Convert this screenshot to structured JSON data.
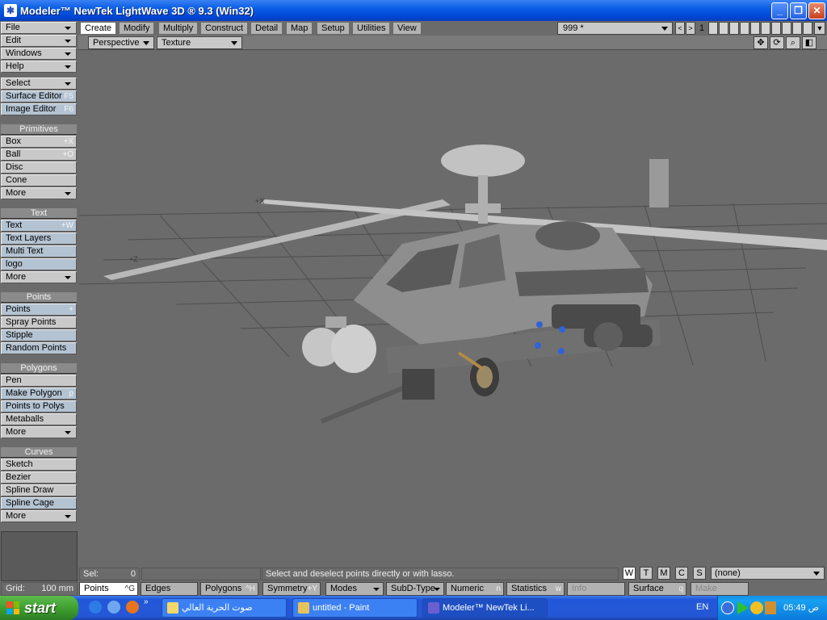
{
  "window": {
    "title": "Modeler™ NewTek LightWave 3D ® 9.3 (Win32)",
    "controls": [
      "_",
      "❐",
      "✕"
    ]
  },
  "left_menu": {
    "top": [
      {
        "label": "File"
      },
      {
        "label": "Edit"
      },
      {
        "label": "Windows"
      },
      {
        "label": "Help"
      }
    ],
    "tools": [
      {
        "label": "Select"
      },
      {
        "label": "Surface Editor",
        "shortcut": "F5"
      },
      {
        "label": "Image Editor",
        "shortcut": "F6"
      }
    ],
    "primitives": {
      "header": "Primitives",
      "items": [
        {
          "label": "Box",
          "shortcut": "+X"
        },
        {
          "label": "Ball",
          "shortcut": "+O"
        },
        {
          "label": "Disc"
        },
        {
          "label": "Cone"
        },
        {
          "label": "More"
        }
      ]
    },
    "text": {
      "header": "Text",
      "items": [
        {
          "label": "Text",
          "shortcut": "+W"
        },
        {
          "label": "Text Layers"
        },
        {
          "label": "Multi Text"
        },
        {
          "label": "logo"
        },
        {
          "label": "More"
        }
      ]
    },
    "points": {
      "header": "Points",
      "items": [
        {
          "label": "Points",
          "shortcut": "+"
        },
        {
          "label": "Spray Points"
        },
        {
          "label": "Stipple"
        },
        {
          "label": "Random Points"
        }
      ]
    },
    "polygons": {
      "header": "Polygons",
      "items": [
        {
          "label": "Pen"
        },
        {
          "label": "Make Polygon",
          "shortcut": "p"
        },
        {
          "label": "Points to Polys"
        },
        {
          "label": "Metaballs"
        },
        {
          "label": "More"
        }
      ]
    },
    "curves": {
      "header": "Curves",
      "items": [
        {
          "label": "Sketch"
        },
        {
          "label": "Bezier"
        },
        {
          "label": "Spline Draw"
        },
        {
          "label": "Spline Cage"
        },
        {
          "label": "More"
        }
      ]
    }
  },
  "tabs": [
    "Create",
    "Modify",
    "Multiply",
    "Construct",
    "Detail",
    "Map",
    "Setup",
    "Utilities",
    "View"
  ],
  "active_tab": "Create",
  "layer": {
    "value": "999 *",
    "prev": "<",
    "next": ">",
    "number": "1"
  },
  "viewport": {
    "projection": "Perspective",
    "shading": "Texture",
    "icons": [
      "move-icon",
      "rotate-icon",
      "zoom-icon",
      "maximize-icon"
    ]
  },
  "status": {
    "sel_label": "Sel:",
    "sel_value": "0",
    "message": "Select and deselect points directly or with lasso.",
    "modes": [
      "W",
      "T",
      "M",
      "C",
      "S"
    ],
    "surface": "(none)"
  },
  "bottom": {
    "grid_label": "Grid:",
    "grid_value": "100 mm",
    "buttons": [
      {
        "label": "Points",
        "shortcut": "^G"
      },
      {
        "label": "Edges"
      },
      {
        "label": "Polygons",
        "shortcut": "^H"
      },
      {
        "label": "Symmetry",
        "shortcut": "+Y"
      },
      {
        "label": "Modes"
      },
      {
        "label": "SubD-Type"
      },
      {
        "label": "Numeric",
        "shortcut": "n"
      },
      {
        "label": "Statistics",
        "shortcut": "w"
      },
      {
        "label": "Info"
      },
      {
        "label": "Surface",
        "shortcut": "q"
      },
      {
        "label": "Make"
      }
    ]
  },
  "taskbar": {
    "start": "start",
    "items": [
      {
        "label": "صوت الحرية العالي"
      },
      {
        "label": "untitled - Paint"
      },
      {
        "label": "Modeler™ NewTek Li..."
      }
    ],
    "lang": "EN",
    "time": "05:49 ص"
  },
  "colors": {
    "panel": "#6b6b6b",
    "button": "#c9c9c9",
    "button_blue": "#b4c3d2",
    "header": "#8a8a8a",
    "xp_blue": "#2457d6",
    "start_green": "#3a9a2d"
  }
}
